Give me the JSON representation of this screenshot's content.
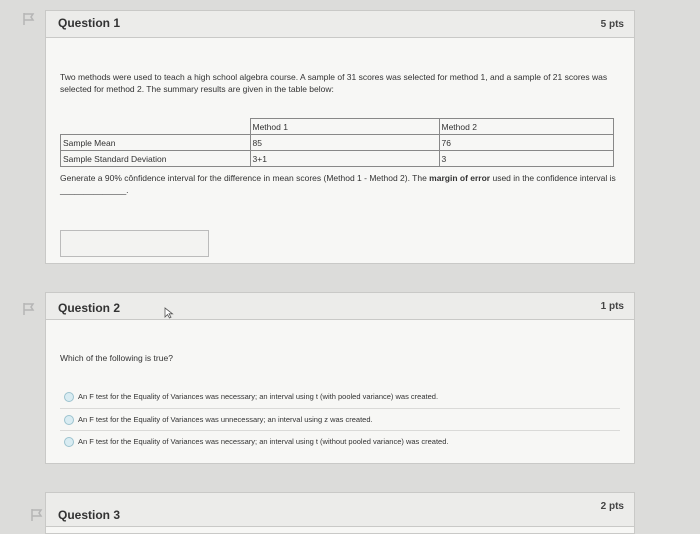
{
  "questions": [
    {
      "title": "Question 1",
      "points": "5 pts",
      "prompt": "Two methods were used to teach a high school algebra course. A sample of 31 scores was selected for method 1, and a sample of 21 scores was selected for method 2. The summary results are given in the table below:",
      "table": {
        "headers": [
          "",
          "Method 1",
          "Method 2"
        ],
        "rows": [
          [
            "Sample Mean",
            "85",
            "76"
          ],
          [
            "Sample Standard Deviation",
            "3+1",
            "3"
          ]
        ]
      },
      "instruction_prefix": "Generate a 90% cônfidence interval for the difference in mean scores (Method 1 - Method 2). The ",
      "instruction_bold": "margin of error",
      "instruction_suffix": " used in the confidence interval is ______________.",
      "answer_value": ""
    },
    {
      "title": "Question 2",
      "points": "1 pts",
      "prompt": "Which of the following is true?",
      "options": [
        "An F test for the Equality of Variances was necessary; an interval using t (with pooled variance) was created.",
        "An F test for the Equality of Variances was unnecessary; an interval using z was created.",
        "An F test for the Equality of Variances was necessary; an interval using t (without pooled variance) was created."
      ]
    },
    {
      "title": "Question 3",
      "points": "2 pts"
    }
  ],
  "icons": {
    "flag": "flag-icon",
    "cursor": "mouse-pointer-icon"
  }
}
